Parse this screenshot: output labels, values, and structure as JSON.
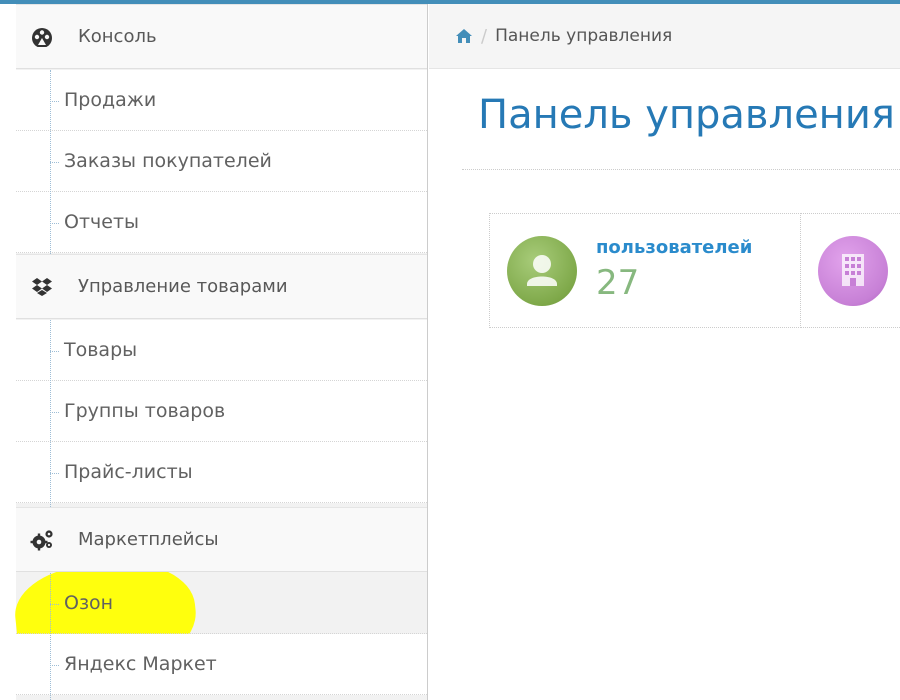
{
  "breadcrumb": {
    "home_icon": "home-icon",
    "separator": "/",
    "current": "Панель управления"
  },
  "page": {
    "title": "Панель управления"
  },
  "sidebar": {
    "groups": [
      {
        "icon": "dashboard-icon",
        "label": "Консоль",
        "items": [
          "Продажи",
          "Заказы покупателей",
          "Отчеты"
        ]
      },
      {
        "icon": "dropbox-icon",
        "label": "Управление товарами",
        "items": [
          "Товары",
          "Группы товаров",
          "Прайс-листы"
        ]
      },
      {
        "icon": "gears-icon",
        "label": "Маркетплейсы",
        "items": [
          "Озон",
          "Яндекс Маркет"
        ]
      }
    ]
  },
  "stats": {
    "users": {
      "icon": "user-icon",
      "label": "пользователей",
      "value": "27",
      "color": "#87b87f"
    },
    "companies": {
      "icon": "building-icon",
      "color": "#c780d6"
    }
  },
  "colors": {
    "accent": "#438eb9",
    "title": "#2679b5",
    "link": "#2a8bcc",
    "highlight": "#ffff00"
  }
}
